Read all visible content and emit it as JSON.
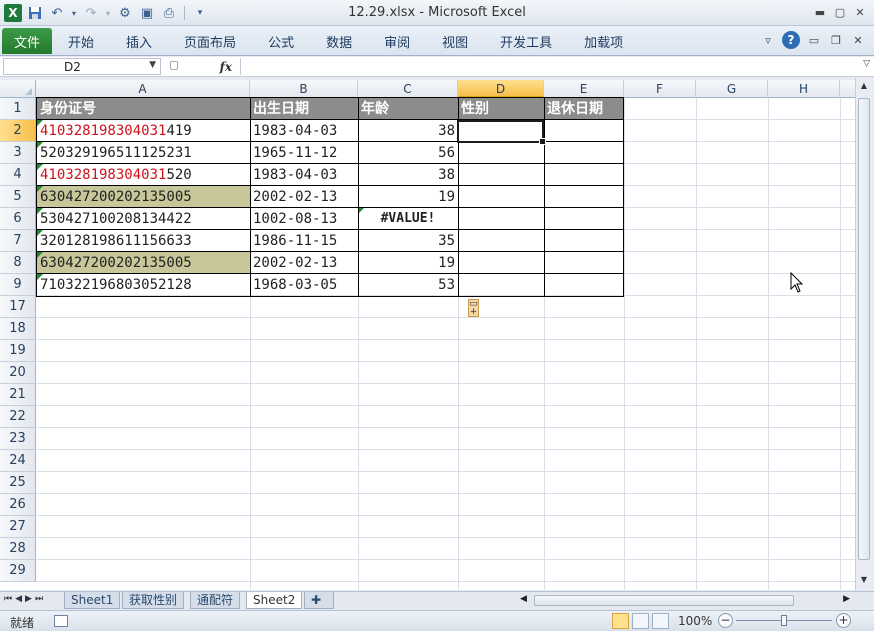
{
  "window": {
    "title": "12.29.xlsx  -  Microsoft Excel"
  },
  "ribbon": {
    "tabs": [
      "文件",
      "开始",
      "插入",
      "页面布局",
      "公式",
      "数据",
      "审阅",
      "视图",
      "开发工具",
      "加载项"
    ],
    "active_tab": "文件",
    "help_icon": "?"
  },
  "formula_bar": {
    "name_box": "D2",
    "fx_label": "fx",
    "content": ""
  },
  "columns": [
    "A",
    "B",
    "C",
    "D",
    "E",
    "F",
    "G",
    "H"
  ],
  "selected_column": "D",
  "rows": [
    "1",
    "2",
    "3",
    "4",
    "5",
    "6",
    "7",
    "8",
    "9",
    "17",
    "18",
    "19",
    "20",
    "21",
    "22",
    "23",
    "24",
    "25",
    "26",
    "27",
    "28",
    "29"
  ],
  "selected_row": "2",
  "table": {
    "headers": [
      "身份证号",
      "出生日期",
      "年龄",
      "性别",
      "退休日期"
    ],
    "records": [
      {
        "id_red": "410328198304031",
        "id_rest": "419",
        "birth": "1983-04-03",
        "age": "38",
        "id_style": "red"
      },
      {
        "id_red": "",
        "id_rest": "520329196511125231",
        "birth": "1965-11-12",
        "age": "56",
        "id_style": "normal"
      },
      {
        "id_red": "410328198304031",
        "id_rest": "520",
        "birth": "1983-04-03",
        "age": "38",
        "id_style": "red"
      },
      {
        "id_red": "",
        "id_rest": "630427200202135005",
        "birth": "2002-02-13",
        "age": "19",
        "id_style": "highlight"
      },
      {
        "id_red": "",
        "id_rest": "530427100208134422",
        "birth": "1002-08-13",
        "age": "#VALUE!",
        "id_style": "normal"
      },
      {
        "id_red": "",
        "id_rest": "320128198611156633",
        "birth": "1986-11-15",
        "age": "35",
        "id_style": "normal"
      },
      {
        "id_red": "",
        "id_rest": "630427200202135005",
        "birth": "2002-02-13",
        "age": "19",
        "id_style": "highlight"
      },
      {
        "id_red": "",
        "id_rest": "710322196803052128",
        "birth": "1968-03-05",
        "age": "53",
        "id_style": "normal"
      }
    ]
  },
  "sheets": [
    "Sheet1",
    "获取性别",
    "通配符",
    "Sheet2"
  ],
  "active_sheet": "Sheet2",
  "status": {
    "ready": "就绪",
    "zoom": "100%"
  },
  "colors": {
    "header_bg": "#8c8c8c",
    "highlight_bg": "#c8c79a",
    "red_text": "#d0121b",
    "file_tab": "#2e8b3a"
  }
}
